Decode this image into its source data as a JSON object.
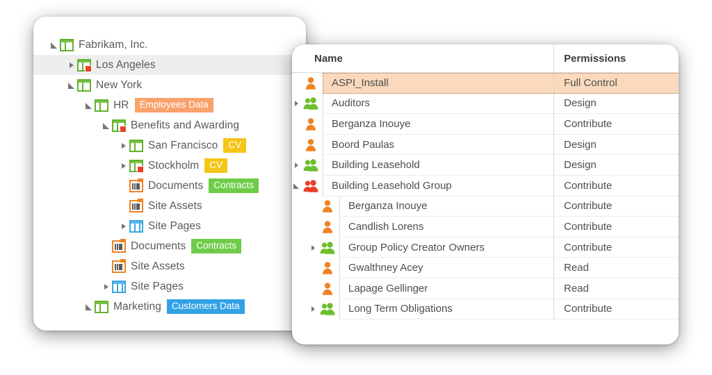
{
  "tree": {
    "items": [
      {
        "label": "Fabrikam, Inc.",
        "icon": "site-icon",
        "state": "expanded",
        "indent": 0,
        "locked": false,
        "selected": false,
        "tag": null,
        "tag_color": null
      },
      {
        "label": "Los Angeles",
        "icon": "site-icon",
        "state": "collapsed",
        "indent": 1,
        "locked": true,
        "selected": true,
        "tag": null,
        "tag_color": null
      },
      {
        "label": "New York",
        "icon": "site-icon",
        "state": "expanded",
        "indent": 1,
        "locked": false,
        "selected": false,
        "tag": null,
        "tag_color": null
      },
      {
        "label": "HR",
        "icon": "site-icon",
        "state": "expanded",
        "indent": 2,
        "locked": false,
        "selected": false,
        "tag": "Employees Data",
        "tag_color": "#f9a26c"
      },
      {
        "label": "Benefits and Awarding",
        "icon": "site-icon",
        "state": "expanded",
        "indent": 3,
        "locked": true,
        "selected": false,
        "tag": null,
        "tag_color": null
      },
      {
        "label": "San Francisco",
        "icon": "site-icon",
        "state": "collapsed",
        "indent": 4,
        "locked": false,
        "selected": false,
        "tag": "CV",
        "tag_color": "#f5c518"
      },
      {
        "label": "Stockholm",
        "icon": "site-icon",
        "state": "collapsed",
        "indent": 4,
        "locked": true,
        "selected": false,
        "tag": "CV",
        "tag_color": "#f5c518"
      },
      {
        "label": "Documents",
        "icon": "document-library-icon",
        "state": "leaf",
        "indent": 4,
        "locked": false,
        "selected": false,
        "tag": "Contracts",
        "tag_color": "#6fcc48"
      },
      {
        "label": "Site Assets",
        "icon": "document-library-icon",
        "state": "leaf",
        "indent": 4,
        "locked": false,
        "selected": false,
        "tag": null,
        "tag_color": null
      },
      {
        "label": "Site Pages",
        "icon": "site-pages-icon",
        "state": "collapsed",
        "indent": 4,
        "locked": false,
        "selected": false,
        "tag": null,
        "tag_color": null
      },
      {
        "label": "Documents",
        "icon": "document-library-icon",
        "state": "leaf",
        "indent": 3,
        "locked": false,
        "selected": false,
        "tag": "Contracts",
        "tag_color": "#6fcc48"
      },
      {
        "label": "Site Assets",
        "icon": "document-library-icon",
        "state": "leaf",
        "indent": 3,
        "locked": false,
        "selected": false,
        "tag": null,
        "tag_color": null
      },
      {
        "label": "Site Pages",
        "icon": "site-pages-icon",
        "state": "collapsed",
        "indent": 3,
        "locked": false,
        "selected": false,
        "tag": null,
        "tag_color": null
      },
      {
        "label": "Marketing",
        "icon": "site-icon",
        "state": "expanded",
        "indent": 2,
        "locked": false,
        "selected": false,
        "tag": "Customers Data",
        "tag_color": "#31a2e5"
      }
    ]
  },
  "permissions": {
    "columns": {
      "name": "Name",
      "permissions": "Permissions"
    },
    "rows": [
      {
        "name": "ASPI_Install",
        "permission": "Full Control",
        "icon": "user-icon",
        "icon_color": "#f08322",
        "state": "leaf",
        "indent": 0,
        "highlight": true
      },
      {
        "name": "Auditors",
        "permission": "Design",
        "icon": "group-icon",
        "icon_color": "#6fbe2c",
        "state": "collapsed",
        "indent": 0,
        "highlight": false
      },
      {
        "name": "Berganza Inouye",
        "permission": "Contribute",
        "icon": "user-icon",
        "icon_color": "#f08322",
        "state": "leaf",
        "indent": 0,
        "highlight": false
      },
      {
        "name": "Boord Paulas",
        "permission": "Design",
        "icon": "user-icon",
        "icon_color": "#f08322",
        "state": "leaf",
        "indent": 0,
        "highlight": false
      },
      {
        "name": "Building Leasehold",
        "permission": "Design",
        "icon": "group-icon",
        "icon_color": "#6fbe2c",
        "state": "collapsed",
        "indent": 0,
        "highlight": false
      },
      {
        "name": "Building Leasehold Group",
        "permission": "Contribute",
        "icon": "group-icon",
        "icon_color": "#e8402a",
        "state": "expanded",
        "indent": 0,
        "highlight": false
      },
      {
        "name": "Berganza Inouye",
        "permission": "Contribute",
        "icon": "user-icon",
        "icon_color": "#f08322",
        "state": "leaf",
        "indent": 1,
        "highlight": false
      },
      {
        "name": "Candlish Lorens",
        "permission": "Contribute",
        "icon": "user-icon",
        "icon_color": "#f08322",
        "state": "leaf",
        "indent": 1,
        "highlight": false
      },
      {
        "name": "Group Policy Creator Owners",
        "permission": "Contribute",
        "icon": "group-icon",
        "icon_color": "#6fbe2c",
        "state": "collapsed",
        "indent": 1,
        "highlight": false
      },
      {
        "name": "Gwalthney Acey",
        "permission": "Read",
        "icon": "user-icon",
        "icon_color": "#f08322",
        "state": "leaf",
        "indent": 1,
        "highlight": false
      },
      {
        "name": "Lapage Gellinger",
        "permission": "Read",
        "icon": "user-icon",
        "icon_color": "#f08322",
        "state": "leaf",
        "indent": 1,
        "highlight": false
      },
      {
        "name": "Long Term Obligations",
        "permission": "Contribute",
        "icon": "group-icon",
        "icon_color": "#6fbe2c",
        "state": "collapsed",
        "indent": 1,
        "highlight": false
      }
    ]
  },
  "colors": {
    "site_icon": "#62b22e",
    "library_icon": "#f08322",
    "pages_icon": "#3ca5e0",
    "lock_badge": "#e8402a",
    "selection": "#eeeeee",
    "row_highlight": "#fad9bd"
  }
}
